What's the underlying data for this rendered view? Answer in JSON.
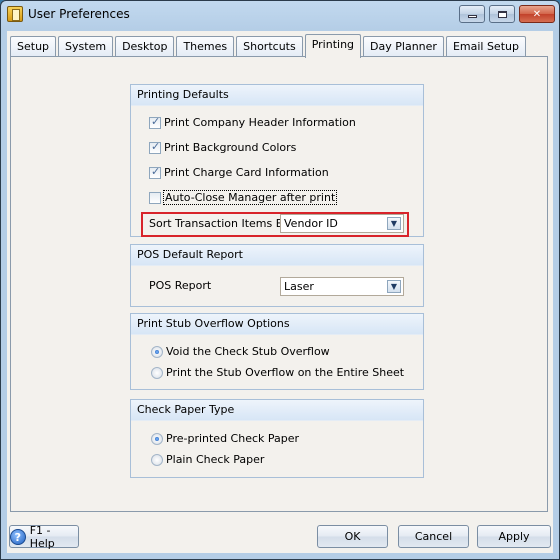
{
  "window": {
    "title": "User Preferences",
    "icons": {
      "app": "app-folder-icon",
      "minimize": "minimize-icon",
      "maximize": "maximize-icon",
      "close": "close-icon"
    }
  },
  "tabs": [
    {
      "label": "Setup",
      "active": false
    },
    {
      "label": "System",
      "active": false
    },
    {
      "label": "Desktop",
      "active": false
    },
    {
      "label": "Themes",
      "active": false
    },
    {
      "label": "Shortcuts",
      "active": false
    },
    {
      "label": "Printing",
      "active": true
    },
    {
      "label": "Day Planner",
      "active": false
    },
    {
      "label": "Email Setup",
      "active": false
    }
  ],
  "printing_defaults": {
    "header": "Printing Defaults",
    "checkboxes": [
      {
        "label": "Print Company Header Information",
        "checked": true
      },
      {
        "label": "Print Background Colors",
        "checked": true
      },
      {
        "label": "Print Charge Card Information",
        "checked": true
      },
      {
        "label": "Auto-Close Manager after print",
        "checked": false
      }
    ],
    "sort_label": "Sort Transaction Items By",
    "sort_value": "Vendor ID",
    "highlight_color": "#d8232a"
  },
  "pos_default_report": {
    "header": "POS Default Report",
    "label": "POS Report",
    "value": "Laser"
  },
  "stub_overflow": {
    "header": "Print Stub Overflow Options",
    "options": [
      {
        "label": "Void the Check Stub Overflow",
        "selected": true
      },
      {
        "label": "Print the Stub Overflow on the Entire Sheet",
        "selected": false
      }
    ]
  },
  "check_paper": {
    "header": "Check Paper Type",
    "options": [
      {
        "label": "Pre-printed Check Paper",
        "selected": true
      },
      {
        "label": "Plain Check Paper",
        "selected": false
      }
    ]
  },
  "footer": {
    "help_label": "F1 - Help",
    "ok_label": "OK",
    "cancel_label": "Cancel",
    "apply_label": "Apply"
  }
}
